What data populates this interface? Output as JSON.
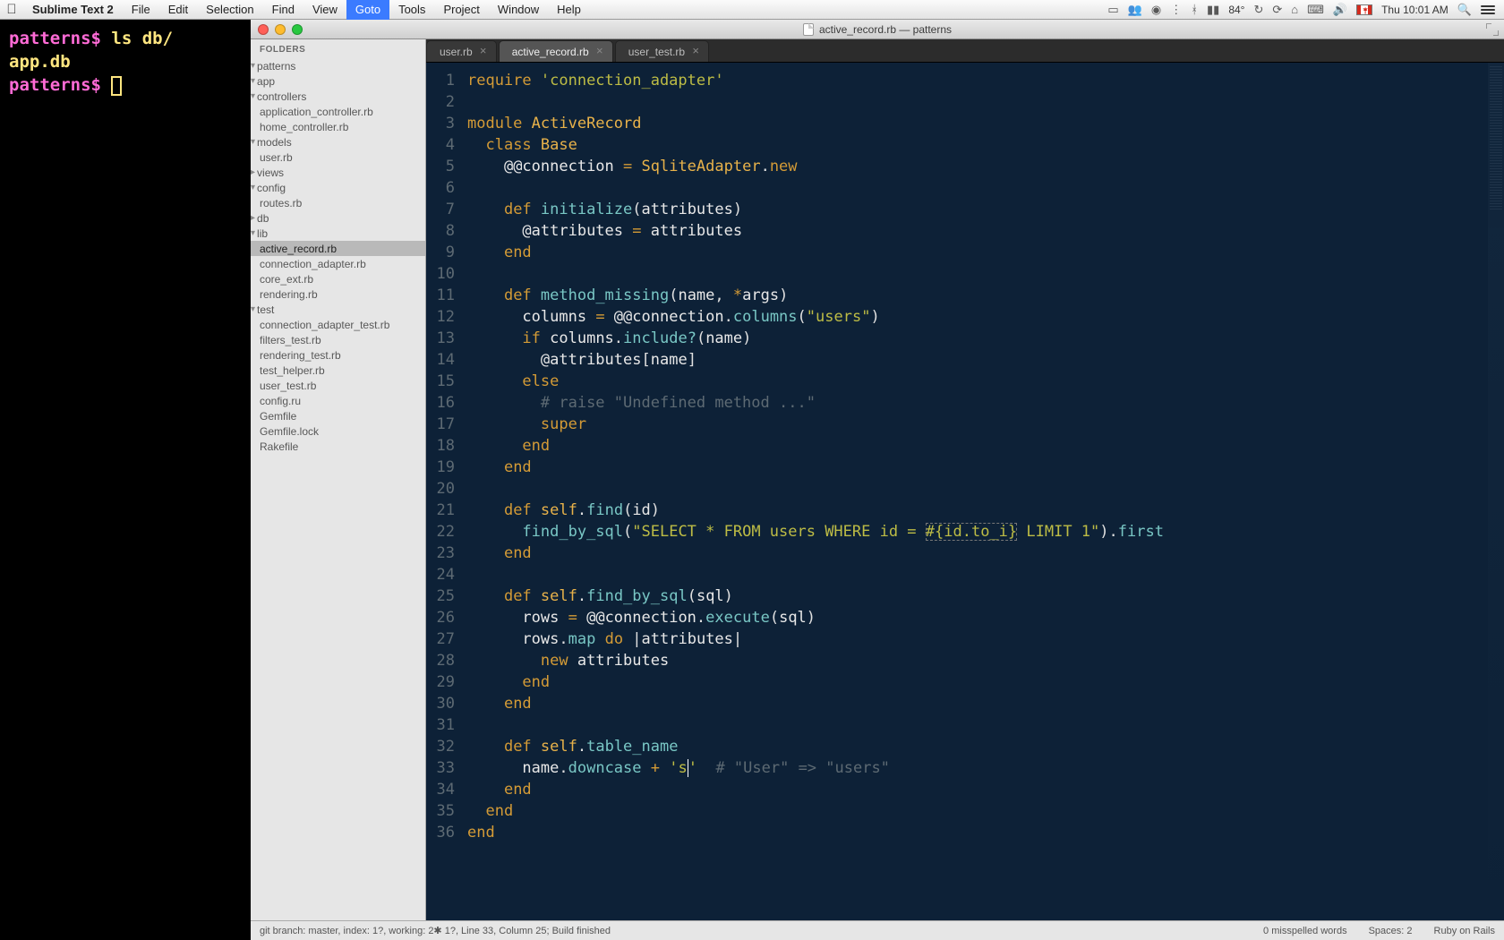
{
  "menubar": {
    "app": "Sublime Text 2",
    "items": [
      "File",
      "Edit",
      "Selection",
      "Find",
      "View",
      "Goto",
      "Tools",
      "Project",
      "Window",
      "Help"
    ],
    "active_index": 5,
    "right": {
      "temp": "84°",
      "clock": "Thu 10:01 AM"
    }
  },
  "terminal": {
    "lines": [
      {
        "prompt": "patterns$ ",
        "text": "ls db/"
      },
      {
        "prompt": "",
        "text": "app.db"
      },
      {
        "prompt": "patterns$ ",
        "text": ""
      }
    ]
  },
  "titlebar": {
    "title": "active_record.rb — patterns"
  },
  "sidebar": {
    "heading": "FOLDERS",
    "tree": [
      {
        "l": "patterns",
        "d": 0,
        "f": true,
        "o": true
      },
      {
        "l": "app",
        "d": 1,
        "f": true,
        "o": true
      },
      {
        "l": "controllers",
        "d": 2,
        "f": true,
        "o": true
      },
      {
        "l": "application_controller.rb",
        "d": 3
      },
      {
        "l": "home_controller.rb",
        "d": 3
      },
      {
        "l": "models",
        "d": 2,
        "f": true,
        "o": true
      },
      {
        "l": "user.rb",
        "d": 3
      },
      {
        "l": "views",
        "d": 2,
        "f": true,
        "o": false
      },
      {
        "l": "config",
        "d": 1,
        "f": true,
        "o": true
      },
      {
        "l": "routes.rb",
        "d": 2
      },
      {
        "l": "db",
        "d": 1,
        "f": true,
        "o": false
      },
      {
        "l": "lib",
        "d": 1,
        "f": true,
        "o": true
      },
      {
        "l": "active_record.rb",
        "d": 2,
        "sel": true
      },
      {
        "l": "connection_adapter.rb",
        "d": 2
      },
      {
        "l": "core_ext.rb",
        "d": 2
      },
      {
        "l": "rendering.rb",
        "d": 2
      },
      {
        "l": "test",
        "d": 1,
        "f": true,
        "o": true
      },
      {
        "l": "connection_adapter_test.rb",
        "d": 2
      },
      {
        "l": "filters_test.rb",
        "d": 2
      },
      {
        "l": "rendering_test.rb",
        "d": 2
      },
      {
        "l": "test_helper.rb",
        "d": 2
      },
      {
        "l": "user_test.rb",
        "d": 2
      },
      {
        "l": "config.ru",
        "d": 1
      },
      {
        "l": "Gemfile",
        "d": 1
      },
      {
        "l": "Gemfile.lock",
        "d": 1
      },
      {
        "l": "Rakefile",
        "d": 1
      }
    ]
  },
  "tabs": [
    {
      "label": "user.rb"
    },
    {
      "label": "active_record.rb",
      "active": true
    },
    {
      "label": "user_test.rb"
    }
  ],
  "code_lines": [
    [
      [
        "kw",
        "require "
      ],
      [
        "str",
        "'connection_adapter'"
      ]
    ],
    [],
    [
      [
        "kw",
        "module "
      ],
      [
        "const",
        "ActiveRecord"
      ]
    ],
    [
      [
        "id",
        "  "
      ],
      [
        "kw",
        "class "
      ],
      [
        "const",
        "Base"
      ]
    ],
    [
      [
        "id",
        "    "
      ],
      [
        "id",
        "@@connection"
      ],
      [
        "op",
        " = "
      ],
      [
        "const",
        "SqliteAdapter"
      ],
      [
        "punct",
        "."
      ],
      [
        "kw",
        "new"
      ]
    ],
    [],
    [
      [
        "id",
        "    "
      ],
      [
        "kw",
        "def "
      ],
      [
        "fn",
        "initialize"
      ],
      [
        "punct",
        "("
      ],
      [
        "id",
        "attributes"
      ],
      [
        "punct",
        ")"
      ]
    ],
    [
      [
        "id",
        "      "
      ],
      [
        "id",
        "@attributes"
      ],
      [
        "op",
        " = "
      ],
      [
        "id",
        "attributes"
      ]
    ],
    [
      [
        "id",
        "    "
      ],
      [
        "kw",
        "end"
      ]
    ],
    [],
    [
      [
        "id",
        "    "
      ],
      [
        "kw",
        "def "
      ],
      [
        "fn",
        "method_missing"
      ],
      [
        "punct",
        "("
      ],
      [
        "id",
        "name"
      ],
      [
        "punct",
        ", "
      ],
      [
        "op",
        "*"
      ],
      [
        "id",
        "args"
      ],
      [
        "punct",
        ")"
      ]
    ],
    [
      [
        "id",
        "      "
      ],
      [
        "id",
        "columns"
      ],
      [
        "op",
        " = "
      ],
      [
        "id",
        "@@connection"
      ],
      [
        "punct",
        "."
      ],
      [
        "fn",
        "columns"
      ],
      [
        "punct",
        "("
      ],
      [
        "str",
        "\"users\""
      ],
      [
        "punct",
        ")"
      ]
    ],
    [
      [
        "id",
        "      "
      ],
      [
        "kw",
        "if "
      ],
      [
        "id",
        "columns"
      ],
      [
        "punct",
        "."
      ],
      [
        "fn",
        "include?"
      ],
      [
        "punct",
        "("
      ],
      [
        "id",
        "name"
      ],
      [
        "punct",
        ")"
      ]
    ],
    [
      [
        "id",
        "        "
      ],
      [
        "id",
        "@attributes"
      ],
      [
        "punct",
        "["
      ],
      [
        "id",
        "name"
      ],
      [
        "punct",
        "]"
      ]
    ],
    [
      [
        "id",
        "      "
      ],
      [
        "kw",
        "else"
      ]
    ],
    [
      [
        "id",
        "        "
      ],
      [
        "cmt",
        "# raise \"Undefined method ...\""
      ]
    ],
    [
      [
        "id",
        "        "
      ],
      [
        "kw",
        "super"
      ]
    ],
    [
      [
        "id",
        "      "
      ],
      [
        "kw",
        "end"
      ]
    ],
    [
      [
        "id",
        "    "
      ],
      [
        "kw",
        "end"
      ]
    ],
    [],
    [
      [
        "id",
        "    "
      ],
      [
        "kw",
        "def "
      ],
      [
        "const",
        "self"
      ],
      [
        "punct",
        "."
      ],
      [
        "fn",
        "find"
      ],
      [
        "punct",
        "("
      ],
      [
        "id",
        "id"
      ],
      [
        "punct",
        ")"
      ]
    ],
    [
      [
        "id",
        "      "
      ],
      [
        "fn",
        "find_by_sql"
      ],
      [
        "punct",
        "("
      ],
      [
        "str",
        "\"SELECT * FROM users WHERE id = "
      ],
      [
        "str boxed",
        "#{id.to_i}"
      ],
      [
        "str",
        " LIMIT 1\""
      ],
      [
        "punct",
        ")."
      ],
      [
        "fn",
        "first"
      ]
    ],
    [
      [
        "id",
        "    "
      ],
      [
        "kw",
        "end"
      ]
    ],
    [],
    [
      [
        "id",
        "    "
      ],
      [
        "kw",
        "def "
      ],
      [
        "const",
        "self"
      ],
      [
        "punct",
        "."
      ],
      [
        "fn",
        "find_by_sql"
      ],
      [
        "punct",
        "("
      ],
      [
        "id",
        "sql"
      ],
      [
        "punct",
        ")"
      ]
    ],
    [
      [
        "id",
        "      "
      ],
      [
        "id",
        "rows"
      ],
      [
        "op",
        " = "
      ],
      [
        "id",
        "@@connection"
      ],
      [
        "punct",
        "."
      ],
      [
        "fn",
        "execute"
      ],
      [
        "punct",
        "("
      ],
      [
        "id",
        "sql"
      ],
      [
        "punct",
        ")"
      ]
    ],
    [
      [
        "id",
        "      "
      ],
      [
        "id",
        "rows"
      ],
      [
        "punct",
        "."
      ],
      [
        "fn",
        "map"
      ],
      [
        "op",
        " do "
      ],
      [
        "punct",
        "|"
      ],
      [
        "id",
        "attributes"
      ],
      [
        "punct",
        "|"
      ]
    ],
    [
      [
        "id",
        "        "
      ],
      [
        "kw",
        "new "
      ],
      [
        "id",
        "attributes"
      ]
    ],
    [
      [
        "id",
        "      "
      ],
      [
        "kw",
        "end"
      ]
    ],
    [
      [
        "id",
        "    "
      ],
      [
        "kw",
        "end"
      ]
    ],
    [],
    [
      [
        "id",
        "    "
      ],
      [
        "kw",
        "def "
      ],
      [
        "const",
        "self"
      ],
      [
        "punct",
        "."
      ],
      [
        "fn",
        "table_name"
      ]
    ],
    [
      [
        "id",
        "      "
      ],
      [
        "id",
        "name"
      ],
      [
        "punct",
        "."
      ],
      [
        "fn",
        "downcase"
      ],
      [
        "op",
        " + "
      ],
      [
        "str",
        "'s"
      ],
      [
        "caret",
        ""
      ],
      [
        "str",
        "'"
      ],
      [
        "id",
        "  "
      ],
      [
        "cmt",
        "# \"User\" => \"users\""
      ]
    ],
    [
      [
        "id",
        "    "
      ],
      [
        "kw",
        "end"
      ]
    ],
    [
      [
        "id",
        "  "
      ],
      [
        "kw",
        "end"
      ]
    ],
    [
      [
        "kw",
        "end"
      ]
    ]
  ],
  "status": {
    "left": "git branch: master, index: 1?, working: 2✱ 1?, Line 33, Column 25; Build finished",
    "misspelled": "0 misspelled words",
    "spaces": "Spaces: 2",
    "lang": "Ruby on Rails"
  }
}
